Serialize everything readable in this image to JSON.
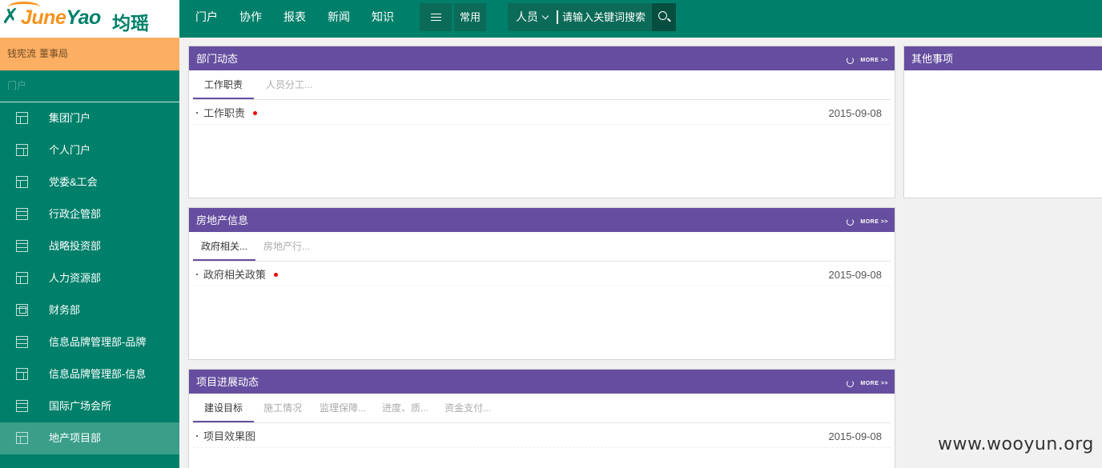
{
  "logo": {
    "brand_prefix": "June",
    "brand_suffix": "Yao",
    "brand_cn": "均瑶"
  },
  "nav": {
    "items": [
      "门户",
      "协作",
      "报表",
      "新闻",
      "知识"
    ],
    "common": "常用"
  },
  "search": {
    "scope": "人员",
    "placeholder": "请输入关键词搜索"
  },
  "user": {
    "name": "钱宪流",
    "dept": "董事局"
  },
  "sidebar": {
    "section": "门户",
    "items": [
      {
        "label": "集团门户"
      },
      {
        "label": "个人门户"
      },
      {
        "label": "党委&工会"
      },
      {
        "label": "行政企管部"
      },
      {
        "label": "战略投资部"
      },
      {
        "label": "人力资源部"
      },
      {
        "label": "财务部"
      },
      {
        "label": "信息品牌管理部-品牌"
      },
      {
        "label": "信息品牌管理部-信息"
      },
      {
        "label": "国际广场会所"
      },
      {
        "label": "地产项目部"
      }
    ],
    "active_index": 10
  },
  "more_label": "MORE >>",
  "panels": {
    "dept_news": {
      "title": "部门动态",
      "tabs": [
        "工作职责",
        "人员分工..."
      ],
      "rows": [
        {
          "title": "工作职责",
          "date": "2015-09-08",
          "new": true
        }
      ]
    },
    "real_estate": {
      "title": "房地产信息",
      "tabs": [
        "政府相关...",
        "房地产行..."
      ],
      "rows": [
        {
          "title": "政府相关政策",
          "date": "2015-09-08",
          "new": true
        }
      ]
    },
    "project_progress": {
      "title": "项目进展动态",
      "tabs": [
        "建设目标",
        "施工情况",
        "监理保障...",
        "进度、质...",
        "资金支付..."
      ],
      "rows": [
        {
          "title": "项目效果图",
          "date": "2015-09-08",
          "new": false
        }
      ]
    },
    "other": {
      "title": "其他事项"
    }
  },
  "watermark": "www.wooyun.org",
  "colors": {
    "primary": "#00806a",
    "panel_header": "#654e9f",
    "user_bar": "#fcae62",
    "new_dot": "#e00000"
  }
}
